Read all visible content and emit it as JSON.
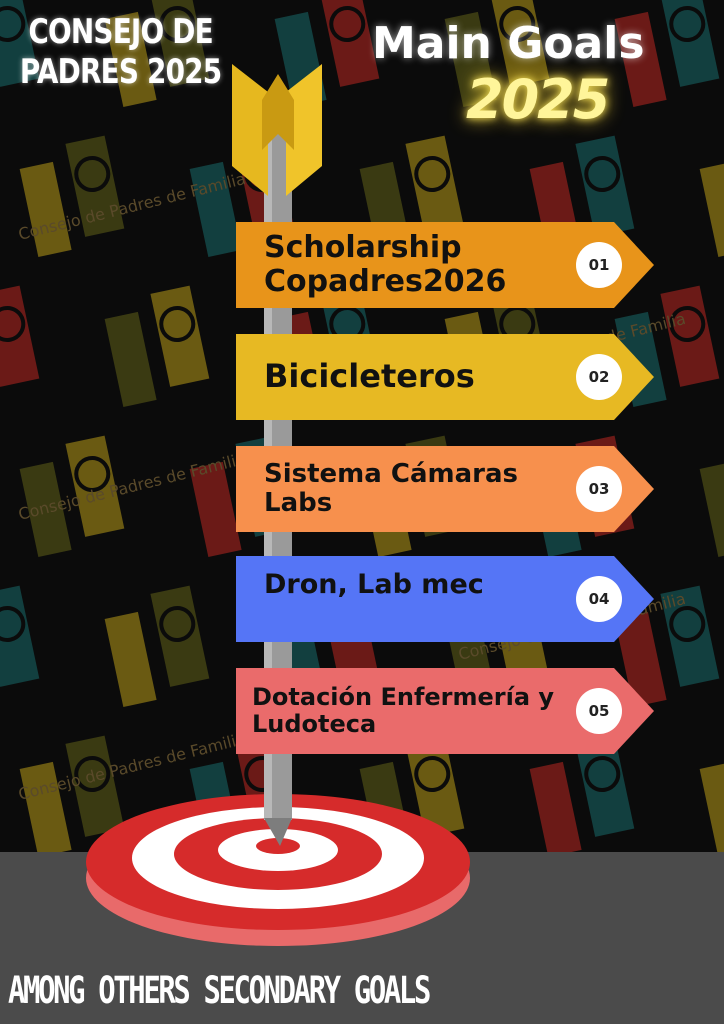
{
  "header": {
    "org_line1": "CONSEJO DE",
    "org_line2": "PADRES 2025",
    "title": "Main Goals",
    "year": "2025"
  },
  "background": {
    "watermark_text": "Consejo de Padres de Familia",
    "pattern_colors": [
      "#6b1a17",
      "#6a5a12",
      "#123f3f",
      "#3a3a12"
    ]
  },
  "goals": [
    {
      "line1": "Scholarship",
      "line2": "Copadres2026",
      "number": "01",
      "color": "#e8941a",
      "font_size": 30
    },
    {
      "line1": "Bicicleteros",
      "line2": "",
      "number": "02",
      "color": "#e7b923",
      "font_size": 32
    },
    {
      "line1": "Sistema Cámaras",
      "line2": "Labs",
      "number": "03",
      "color": "#f7904d",
      "font_size": 26
    },
    {
      "line1": "Dron, Lab mec",
      "line2": "",
      "number": "04",
      "color": "#5575f6",
      "font_size": 27
    },
    {
      "line1": "Dotación Enfermería y",
      "line2": "Ludoteca",
      "number": "05",
      "color": "#ea6b6b",
      "font_size": 24
    }
  ],
  "footer": {
    "text": "AMONG OTHERS SECONDARY GOALS"
  },
  "colors": {
    "arrow_feather": "#e6b81f",
    "target_red": "#d62b2b",
    "target_white": "#ffffff",
    "pole": "#9a9a9a",
    "floor": "#4b4b4b"
  }
}
